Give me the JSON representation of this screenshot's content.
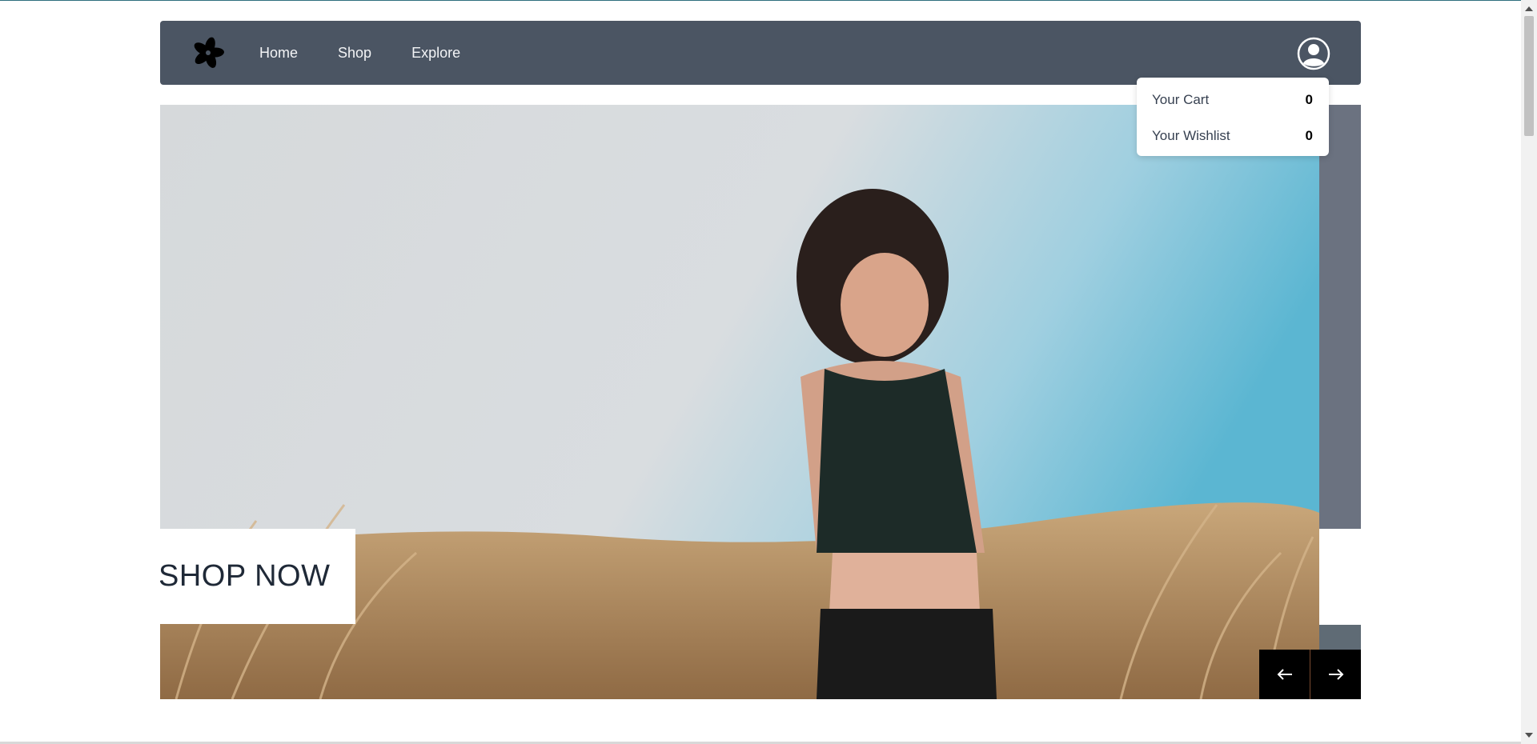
{
  "nav": {
    "links": [
      "Home",
      "Shop",
      "Explore"
    ],
    "logo_icon": "flower-logo-icon",
    "account_icon": "user-circle-icon"
  },
  "dropdown": {
    "cart_label": "Your Cart",
    "cart_count": "0",
    "wishlist_label": "Your Wishlist",
    "wishlist_count": "0"
  },
  "hero": {
    "cta": "SHOP NOW",
    "prev_icon": "arrow-left-icon",
    "next_icon": "arrow-right-icon"
  },
  "colors": {
    "navbar": "#4b5563",
    "nav_text": "#f3f4f6",
    "arrow_bg": "#000000"
  }
}
